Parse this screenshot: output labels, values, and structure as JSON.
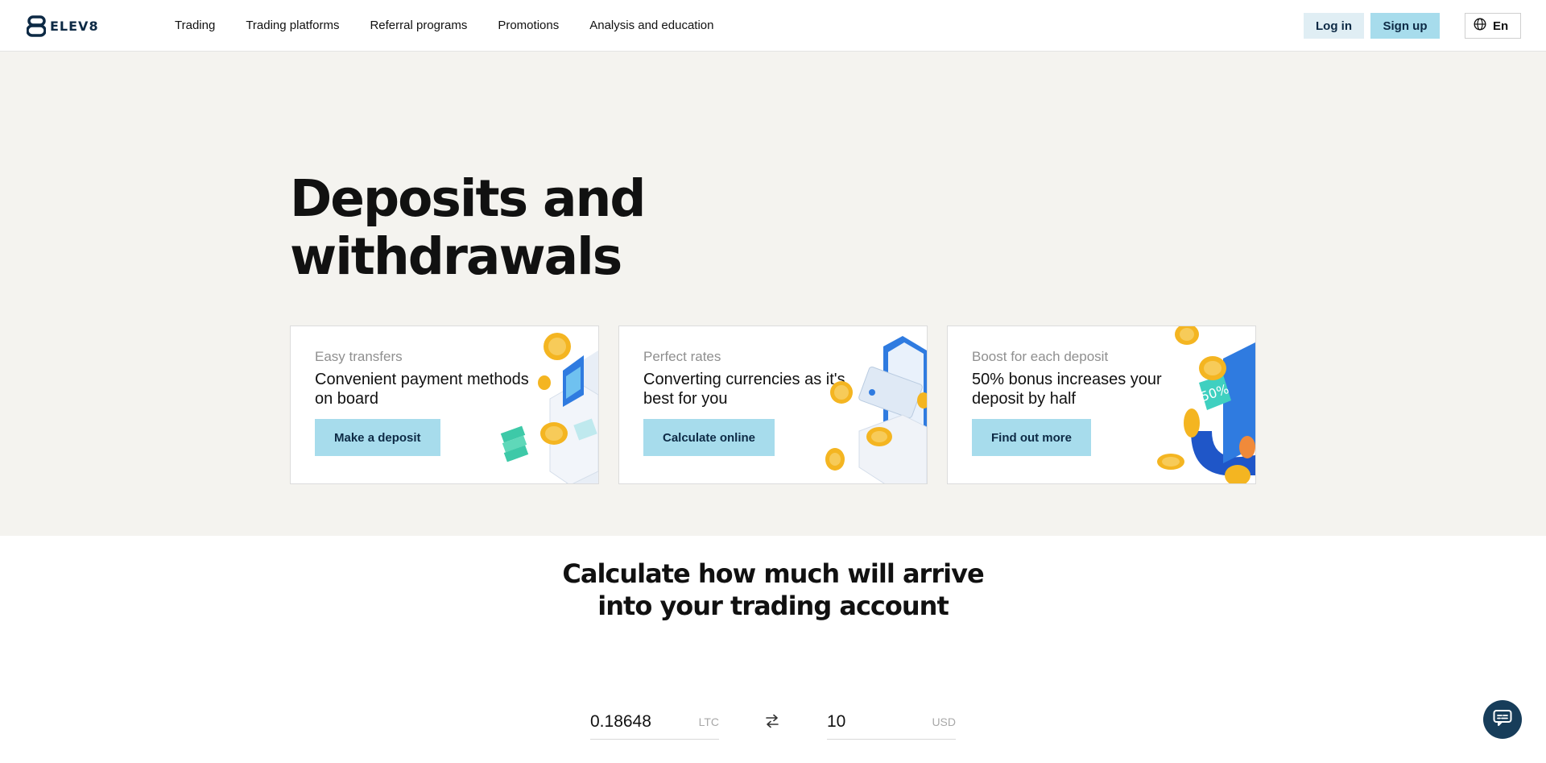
{
  "header": {
    "logo_text": "ELEV8",
    "nav": [
      "Trading",
      "Trading platforms",
      "Referral programs",
      "Promotions",
      "Analysis and education"
    ],
    "login_label": "Log in",
    "signup_label": "Sign up",
    "language": "En",
    "icons": {
      "logo": "elev8-logo-icon",
      "language": "globe-icon"
    }
  },
  "hero": {
    "title_line1": "Deposits and",
    "title_line2": "withdrawals",
    "cards": [
      {
        "eyebrow": "Easy transfers",
        "text": "Convenient payment methods on board",
        "button": "Make a deposit",
        "art": "credit-card-coins-illustration"
      },
      {
        "eyebrow": "Perfect rates",
        "text": "Converting currencies as it's best for you",
        "button": "Calculate online",
        "art": "phone-card-coins-illustration"
      },
      {
        "eyebrow": "Boost for each deposit",
        "text": "50% bonus increases your deposit by half",
        "button": "Find out more",
        "art": "bonus-magnet-illustration",
        "art_badge": "50%"
      }
    ]
  },
  "calculator": {
    "title_line1": "Calculate how much will arrive",
    "title_line2": "into your trading account",
    "from_value": "0.18648",
    "from_unit": "LTC",
    "to_value": "10",
    "to_unit": "USD",
    "swap_icon": "swap-arrows-icon"
  },
  "chat_icon": "chat-icon",
  "colors": {
    "accent": "#a7dcec",
    "accent_light": "#e0eef4",
    "hero_bg": "#f4f3ef",
    "navy": "#0d2a45",
    "coin_gold": "#f4b521"
  }
}
